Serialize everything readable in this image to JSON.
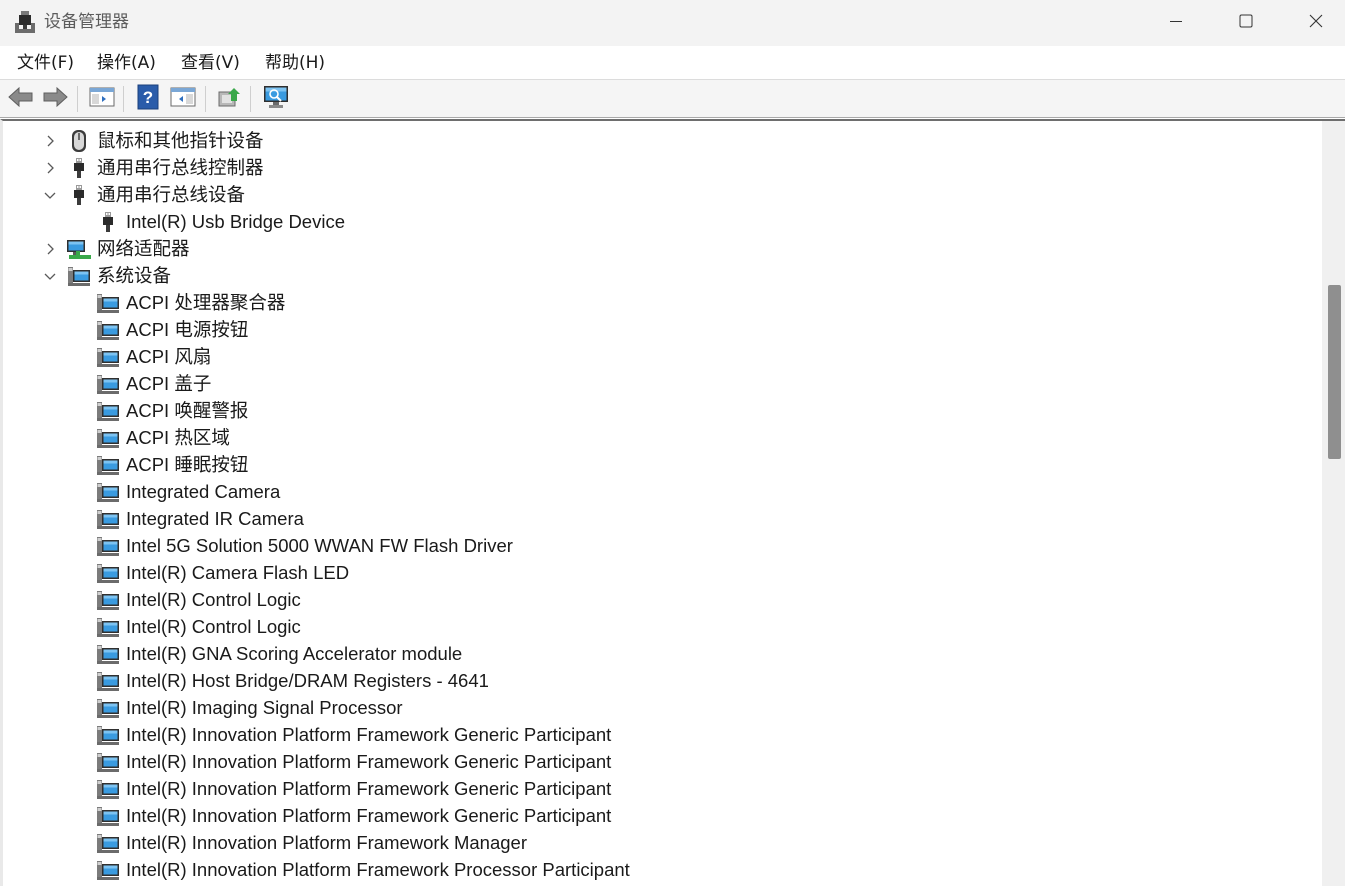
{
  "window": {
    "title": "设备管理器",
    "controls": {
      "minimize": "minimize-icon",
      "maximize": "maximize-icon",
      "close": "close-icon"
    }
  },
  "menu": [
    "文件(F)",
    "操作(A)",
    "查看(V)",
    "帮助(H)"
  ],
  "toolbar": [
    "back-arrow-icon",
    "forward-arrow-icon",
    "show-hide-console-tree-icon",
    "help-icon",
    "properties-pane-icon",
    "update-driver-icon",
    "scan-hardware-changes-icon"
  ],
  "tree": {
    "categories": [
      {
        "label": "鼠标和其他指针设备",
        "icon": "mouse-icon",
        "expanded": false
      },
      {
        "label": "通用串行总线控制器",
        "icon": "usb-icon",
        "expanded": false
      },
      {
        "label": "通用串行总线设备",
        "icon": "usb-icon",
        "expanded": true
      },
      {
        "label": "网络适配器",
        "icon": "network-adapter-icon",
        "expanded": false
      },
      {
        "label": "系统设备",
        "icon": "system-device-icon",
        "expanded": true
      }
    ],
    "usb_devices": [
      "Intel(R) Usb Bridge Device"
    ],
    "system_devices": [
      "ACPI 处理器聚合器",
      "ACPI 电源按钮",
      "ACPI 风扇",
      "ACPI 盖子",
      "ACPI 唤醒警报",
      "ACPI 热区域",
      "ACPI 睡眠按钮",
      "Integrated Camera",
      "Integrated IR Camera",
      "Intel 5G Solution 5000 WWAN FW Flash Driver",
      "Intel(R) Camera Flash LED",
      "Intel(R) Control Logic",
      "Intel(R) Control Logic",
      "Intel(R) GNA Scoring Accelerator module",
      "Intel(R) Host Bridge/DRAM Registers - 4641",
      "Intel(R) Imaging Signal Processor",
      "Intel(R) Innovation Platform Framework Generic Participant",
      "Intel(R) Innovation Platform Framework Generic Participant",
      "Intel(R) Innovation Platform Framework Generic Participant",
      "Intel(R) Innovation Platform Framework Generic Participant",
      "Intel(R) Innovation Platform Framework Manager",
      "Intel(R) Innovation Platform Framework Processor Participant"
    ]
  },
  "colors": {
    "titlebar": "#f3f3f3",
    "toolbar": "#f5f5f5",
    "monitor_blue": "#2f8fd8",
    "scroll_thumb": "#8f8f8f"
  }
}
